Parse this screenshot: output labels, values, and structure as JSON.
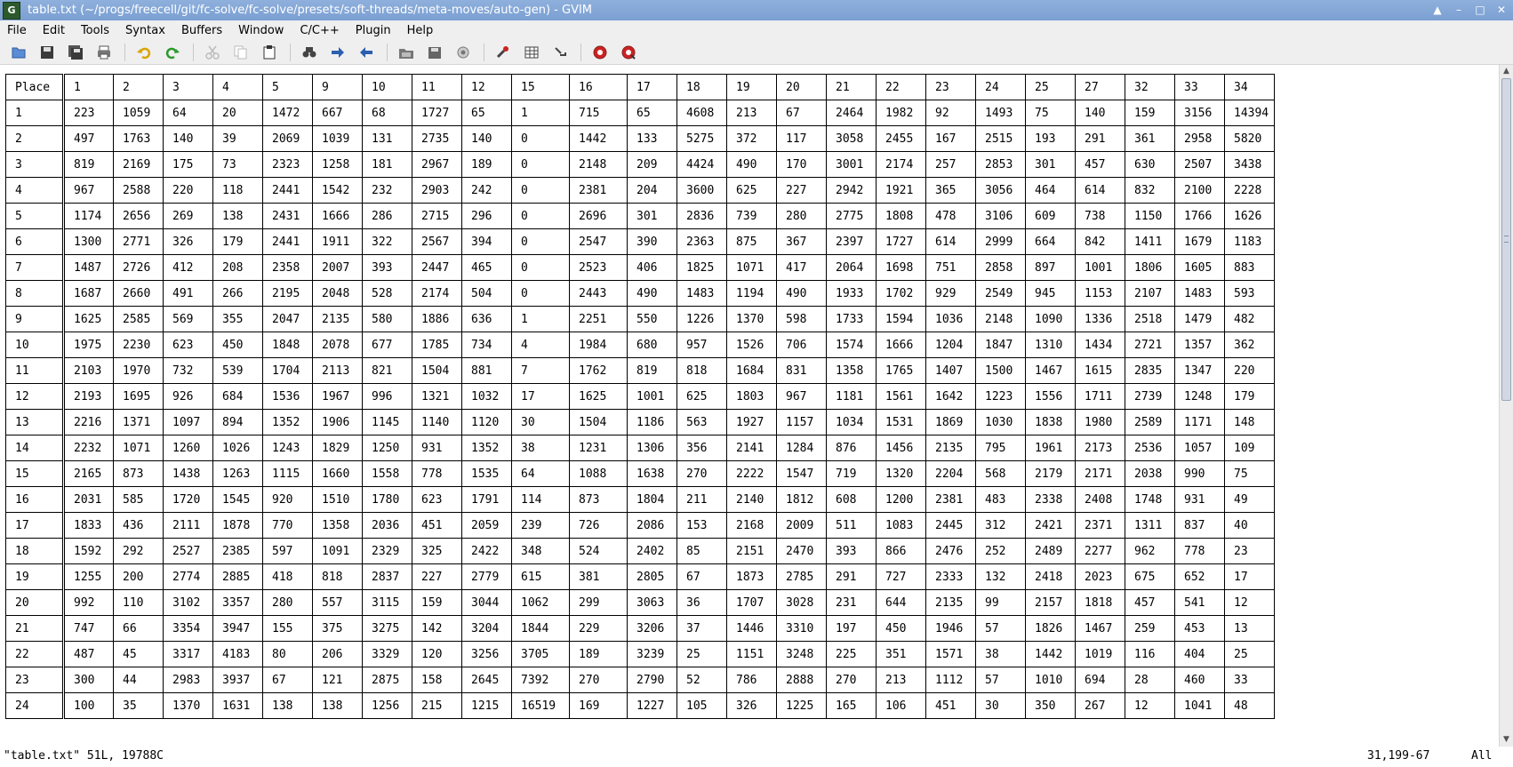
{
  "window": {
    "title": "table.txt (~/progs/freecell/git/fc-solve/fc-solve/presets/soft-threads/meta-moves/auto-gen) - GVIM",
    "app_icon_letter": "G"
  },
  "menu": {
    "items": [
      "File",
      "Edit",
      "Tools",
      "Syntax",
      "Buffers",
      "Window",
      "C/C++",
      "Plugin",
      "Help"
    ]
  },
  "toolbar": {
    "buttons": [
      "open-icon",
      "save-icon",
      "save-all-icon",
      "print-icon",
      "undo-icon",
      "redo-icon",
      "cut-icon",
      "copy-icon",
      "paste-icon",
      "find-replace-icon",
      "find-next-icon",
      "find-prev-icon",
      "load-session-icon",
      "save-session-icon",
      "run-script-icon",
      "make-icon",
      "shell-icon",
      "tags-icon",
      "help-icon",
      "find-help-icon"
    ]
  },
  "table": {
    "header": [
      "Place",
      "1",
      "2",
      "3",
      "4",
      "5",
      "9",
      "10",
      "11",
      "12",
      "15",
      "16",
      "17",
      "18",
      "19",
      "20",
      "21",
      "22",
      "23",
      "24",
      "25",
      "27",
      "32",
      "33",
      "34"
    ],
    "rows": [
      [
        "1",
        "223",
        "1059",
        "64",
        "20",
        "1472",
        "667",
        "68",
        "1727",
        "65",
        "1",
        "715",
        "65",
        "4608",
        "213",
        "67",
        "2464",
        "1982",
        "92",
        "1493",
        "75",
        "140",
        "159",
        "3156",
        "14394"
      ],
      [
        "2",
        "497",
        "1763",
        "140",
        "39",
        "2069",
        "1039",
        "131",
        "2735",
        "140",
        "0",
        "1442",
        "133",
        "5275",
        "372",
        "117",
        "3058",
        "2455",
        "167",
        "2515",
        "193",
        "291",
        "361",
        "2958",
        "5820"
      ],
      [
        "3",
        "819",
        "2169",
        "175",
        "73",
        "2323",
        "1258",
        "181",
        "2967",
        "189",
        "0",
        "2148",
        "209",
        "4424",
        "490",
        "170",
        "3001",
        "2174",
        "257",
        "2853",
        "301",
        "457",
        "630",
        "2507",
        "3438"
      ],
      [
        "4",
        "967",
        "2588",
        "220",
        "118",
        "2441",
        "1542",
        "232",
        "2903",
        "242",
        "0",
        "2381",
        "204",
        "3600",
        "625",
        "227",
        "2942",
        "1921",
        "365",
        "3056",
        "464",
        "614",
        "832",
        "2100",
        "2228"
      ],
      [
        "5",
        "1174",
        "2656",
        "269",
        "138",
        "2431",
        "1666",
        "286",
        "2715",
        "296",
        "0",
        "2696",
        "301",
        "2836",
        "739",
        "280",
        "2775",
        "1808",
        "478",
        "3106",
        "609",
        "738",
        "1150",
        "1766",
        "1626"
      ],
      [
        "6",
        "1300",
        "2771",
        "326",
        "179",
        "2441",
        "1911",
        "322",
        "2567",
        "394",
        "0",
        "2547",
        "390",
        "2363",
        "875",
        "367",
        "2397",
        "1727",
        "614",
        "2999",
        "664",
        "842",
        "1411",
        "1679",
        "1183"
      ],
      [
        "7",
        "1487",
        "2726",
        "412",
        "208",
        "2358",
        "2007",
        "393",
        "2447",
        "465",
        "0",
        "2523",
        "406",
        "1825",
        "1071",
        "417",
        "2064",
        "1698",
        "751",
        "2858",
        "897",
        "1001",
        "1806",
        "1605",
        "883"
      ],
      [
        "8",
        "1687",
        "2660",
        "491",
        "266",
        "2195",
        "2048",
        "528",
        "2174",
        "504",
        "0",
        "2443",
        "490",
        "1483",
        "1194",
        "490",
        "1933",
        "1702",
        "929",
        "2549",
        "945",
        "1153",
        "2107",
        "1483",
        "593"
      ],
      [
        "9",
        "1625",
        "2585",
        "569",
        "355",
        "2047",
        "2135",
        "580",
        "1886",
        "636",
        "1",
        "2251",
        "550",
        "1226",
        "1370",
        "598",
        "1733",
        "1594",
        "1036",
        "2148",
        "1090",
        "1336",
        "2518",
        "1479",
        "482"
      ],
      [
        "10",
        "1975",
        "2230",
        "623",
        "450",
        "1848",
        "2078",
        "677",
        "1785",
        "734",
        "4",
        "1984",
        "680",
        "957",
        "1526",
        "706",
        "1574",
        "1666",
        "1204",
        "1847",
        "1310",
        "1434",
        "2721",
        "1357",
        "362"
      ],
      [
        "11",
        "2103",
        "1970",
        "732",
        "539",
        "1704",
        "2113",
        "821",
        "1504",
        "881",
        "7",
        "1762",
        "819",
        "818",
        "1684",
        "831",
        "1358",
        "1765",
        "1407",
        "1500",
        "1467",
        "1615",
        "2835",
        "1347",
        "220"
      ],
      [
        "12",
        "2193",
        "1695",
        "926",
        "684",
        "1536",
        "1967",
        "996",
        "1321",
        "1032",
        "17",
        "1625",
        "1001",
        "625",
        "1803",
        "967",
        "1181",
        "1561",
        "1642",
        "1223",
        "1556",
        "1711",
        "2739",
        "1248",
        "179"
      ],
      [
        "13",
        "2216",
        "1371",
        "1097",
        "894",
        "1352",
        "1906",
        "1145",
        "1140",
        "1120",
        "30",
        "1504",
        "1186",
        "563",
        "1927",
        "1157",
        "1034",
        "1531",
        "1869",
        "1030",
        "1838",
        "1980",
        "2589",
        "1171",
        "148"
      ],
      [
        "14",
        "2232",
        "1071",
        "1260",
        "1026",
        "1243",
        "1829",
        "1250",
        "931",
        "1352",
        "38",
        "1231",
        "1306",
        "356",
        "2141",
        "1284",
        "876",
        "1456",
        "2135",
        "795",
        "1961",
        "2173",
        "2536",
        "1057",
        "109"
      ],
      [
        "15",
        "2165",
        "873",
        "1438",
        "1263",
        "1115",
        "1660",
        "1558",
        "778",
        "1535",
        "64",
        "1088",
        "1638",
        "270",
        "2222",
        "1547",
        "719",
        "1320",
        "2204",
        "568",
        "2179",
        "2171",
        "2038",
        "990",
        "75"
      ],
      [
        "16",
        "2031",
        "585",
        "1720",
        "1545",
        "920",
        "1510",
        "1780",
        "623",
        "1791",
        "114",
        "873",
        "1804",
        "211",
        "2140",
        "1812",
        "608",
        "1200",
        "2381",
        "483",
        "2338",
        "2408",
        "1748",
        "931",
        "49"
      ],
      [
        "17",
        "1833",
        "436",
        "2111",
        "1878",
        "770",
        "1358",
        "2036",
        "451",
        "2059",
        "239",
        "726",
        "2086",
        "153",
        "2168",
        "2009",
        "511",
        "1083",
        "2445",
        "312",
        "2421",
        "2371",
        "1311",
        "837",
        "40"
      ],
      [
        "18",
        "1592",
        "292",
        "2527",
        "2385",
        "597",
        "1091",
        "2329",
        "325",
        "2422",
        "348",
        "524",
        "2402",
        "85",
        "2151",
        "2470",
        "393",
        "866",
        "2476",
        "252",
        "2489",
        "2277",
        "962",
        "778",
        "23"
      ],
      [
        "19",
        "1255",
        "200",
        "2774",
        "2885",
        "418",
        "818",
        "2837",
        "227",
        "2779",
        "615",
        "381",
        "2805",
        "67",
        "1873",
        "2785",
        "291",
        "727",
        "2333",
        "132",
        "2418",
        "2023",
        "675",
        "652",
        "17"
      ],
      [
        "20",
        "992",
        "110",
        "3102",
        "3357",
        "280",
        "557",
        "3115",
        "159",
        "3044",
        "1062",
        "299",
        "3063",
        "36",
        "1707",
        "3028",
        "231",
        "644",
        "2135",
        "99",
        "2157",
        "1818",
        "457",
        "541",
        "12"
      ],
      [
        "21",
        "747",
        "66",
        "3354",
        "3947",
        "155",
        "375",
        "3275",
        "142",
        "3204",
        "1844",
        "229",
        "3206",
        "37",
        "1446",
        "3310",
        "197",
        "450",
        "1946",
        "57",
        "1826",
        "1467",
        "259",
        "453",
        "13"
      ],
      [
        "22",
        "487",
        "45",
        "3317",
        "4183",
        "80",
        "206",
        "3329",
        "120",
        "3256",
        "3705",
        "189",
        "3239",
        "25",
        "1151",
        "3248",
        "225",
        "351",
        "1571",
        "38",
        "1442",
        "1019",
        "116",
        "404",
        "25"
      ],
      [
        "23",
        "300",
        "44",
        "2983",
        "3937",
        "67",
        "121",
        "2875",
        "158",
        "2645",
        "7392",
        "270",
        "2790",
        "52",
        "786",
        "2888",
        "270",
        "213",
        "1112",
        "57",
        "1010",
        "694",
        "28",
        "460",
        "33"
      ],
      [
        "24",
        "100",
        "35",
        "1370",
        "1631",
        "138",
        "138",
        "1256",
        "215",
        "1215",
        "16519",
        "169",
        "1227",
        "105",
        "326",
        "1225",
        "165",
        "106",
        "451",
        "30",
        "350",
        "267",
        "12",
        "1041",
        "48"
      ]
    ]
  },
  "status": {
    "file_info": "\"table.txt\" 51L, 19788C",
    "cursor_pos": "31,199-67",
    "scroll_pos": "All"
  }
}
